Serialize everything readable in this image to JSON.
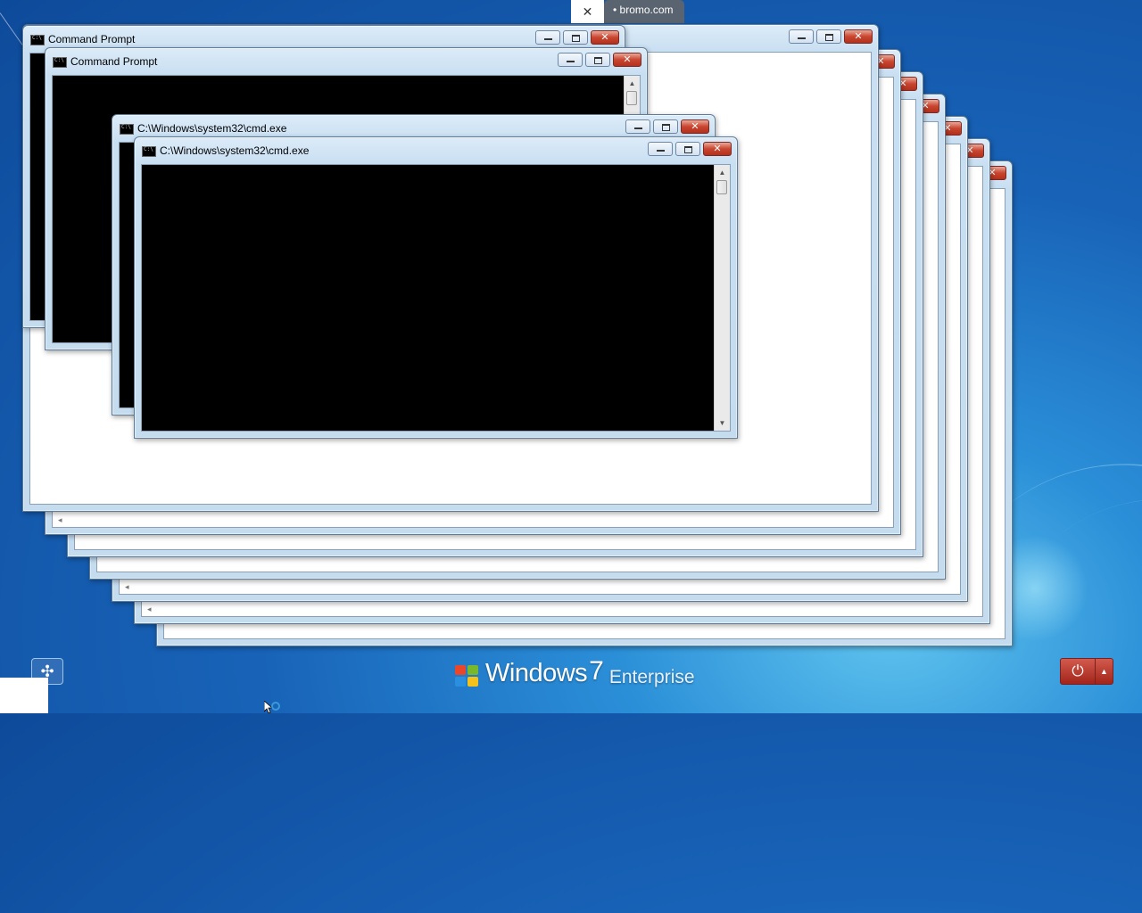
{
  "desktop": {
    "brand": {
      "name": "Windows",
      "version": "7",
      "edition": "Enterprise"
    },
    "ease_of_access_icon": "ease-of-access-icon",
    "power_icon": "power-icon",
    "colors": {
      "background": "#1863b8",
      "close_button": "#c9452f",
      "title_bar": "#c8dff2"
    }
  },
  "browser_tab": {
    "title": "• bromo.com",
    "close": "✕"
  },
  "windows": {
    "cmd_prompt_1": {
      "title": "Command Prompt"
    },
    "cmd_prompt_2": {
      "title": "Command Prompt"
    },
    "cmd_exe_1": {
      "title": "C:\\Windows\\system32\\cmd.exe"
    },
    "cmd_exe_2": {
      "title": "C:\\Windows\\system32\\cmd.exe"
    }
  },
  "controls": {
    "minimize": "minimize-icon",
    "maximize": "maximize-icon",
    "close": "close-icon"
  }
}
